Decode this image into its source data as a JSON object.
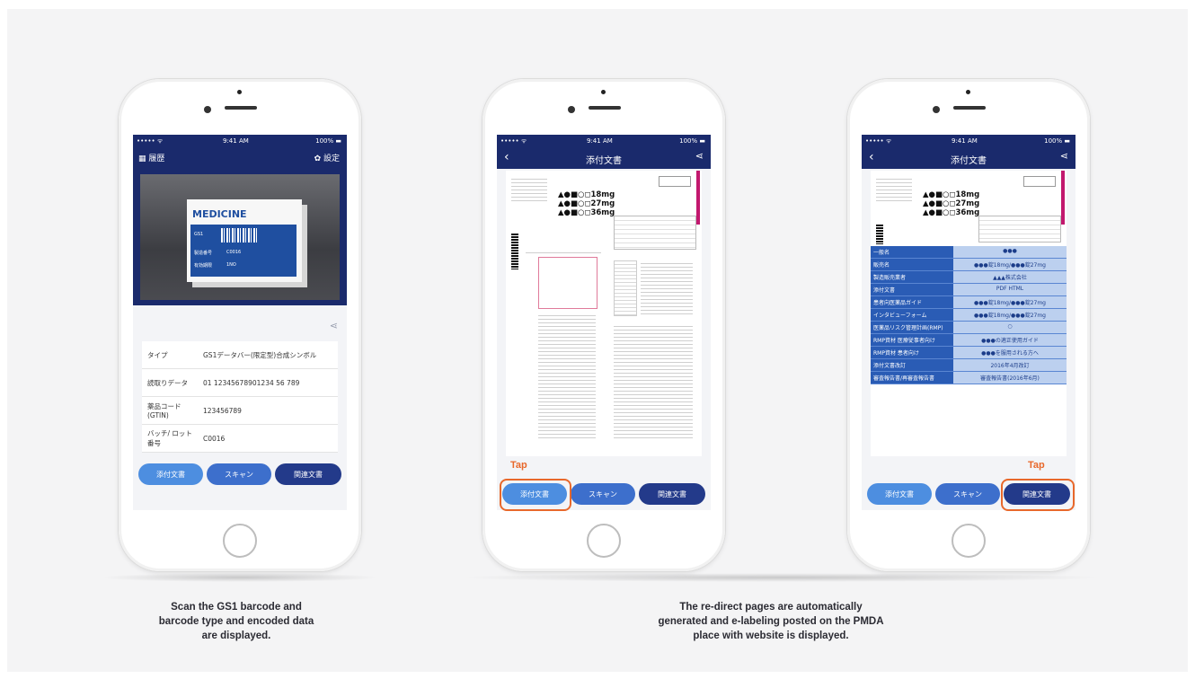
{
  "phone1": {
    "status": {
      "signal": "••••• ᯤ",
      "time": "9:41 AM",
      "battery": "100% ▬"
    },
    "nav": {
      "left_label": "履歴",
      "right_label": "設定"
    },
    "photo": {
      "box_title": "MEDICINE",
      "labels": [
        "GS1",
        "製造番号",
        "有効期限"
      ],
      "values": [
        "C0016",
        "1NO"
      ]
    },
    "rows": [
      {
        "key": "タイプ",
        "value": "GS1データバー(限定型)合成シンボル"
      },
      {
        "key": "読取りデータ",
        "value": "01 12345678901234 56 789"
      },
      {
        "key": "薬品コード (GTIN)",
        "value": "123456789"
      },
      {
        "key": "バッチ/ ロット番号",
        "value": "C0016"
      }
    ],
    "buttons": {
      "attached": "添付文書",
      "scan": "スキャン",
      "related": "関連文書"
    }
  },
  "phone2": {
    "status": {
      "signal": "••••• ᯤ",
      "time": "9:41 AM",
      "battery": "100% ▬"
    },
    "nav": {
      "title": "添付文書"
    },
    "doc_lines": [
      "▲●■○◻18mg",
      "▲●■○◻27mg",
      "▲●■○◻36mg"
    ],
    "buttons": {
      "attached": "添付文書",
      "scan": "スキャン",
      "related": "関連文書"
    },
    "tap_label": "Tap"
  },
  "phone3": {
    "status": {
      "signal": "••••• ᯤ",
      "time": "9:41 AM",
      "battery": "100% ▬"
    },
    "nav": {
      "title": "添付文書"
    },
    "doc_lines": [
      "▲●■○◻18mg",
      "▲●■○◻27mg",
      "▲●■○◻36mg"
    ],
    "table": [
      {
        "key": "一般名",
        "value": "●●●"
      },
      {
        "key": "販売名",
        "value": "●●●錠18mg/●●●錠27mg"
      },
      {
        "key": "製造販売業者",
        "value": "▲▲▲株式会社"
      },
      {
        "key": "添付文書",
        "value": "PDF HTML"
      },
      {
        "key": "患者向医薬品ガイド",
        "value": "●●●錠18mg/●●●錠27mg"
      },
      {
        "key": "インタビューフォーム",
        "value": "●●●錠18mg/●●●錠27mg"
      },
      {
        "key": "医薬品リスク管理計画(RMP)",
        "value": "○"
      },
      {
        "key": "RMP資材 医療従事者向け",
        "value": "●●●の適正使用ガイド"
      },
      {
        "key": "RMP資材 患者向け",
        "value": "●●●を服用される方へ"
      },
      {
        "key": "添付文書改訂",
        "value": "2016年4月改訂"
      },
      {
        "key": "審査報告書/再審査報告書",
        "value": "審査報告書(2016年6月)"
      }
    ],
    "buttons": {
      "attached": "添付文書",
      "scan": "スキャン",
      "related": "関連文書"
    },
    "tap_label": "Tap"
  },
  "captions": {
    "left": [
      "Scan the GS1 barcode and",
      "barcode type and encoded data",
      "are displayed."
    ],
    "right": [
      "The re-direct pages are automatically",
      "generated and e-labeling posted on the PMDA",
      "place with website is displayed."
    ]
  }
}
